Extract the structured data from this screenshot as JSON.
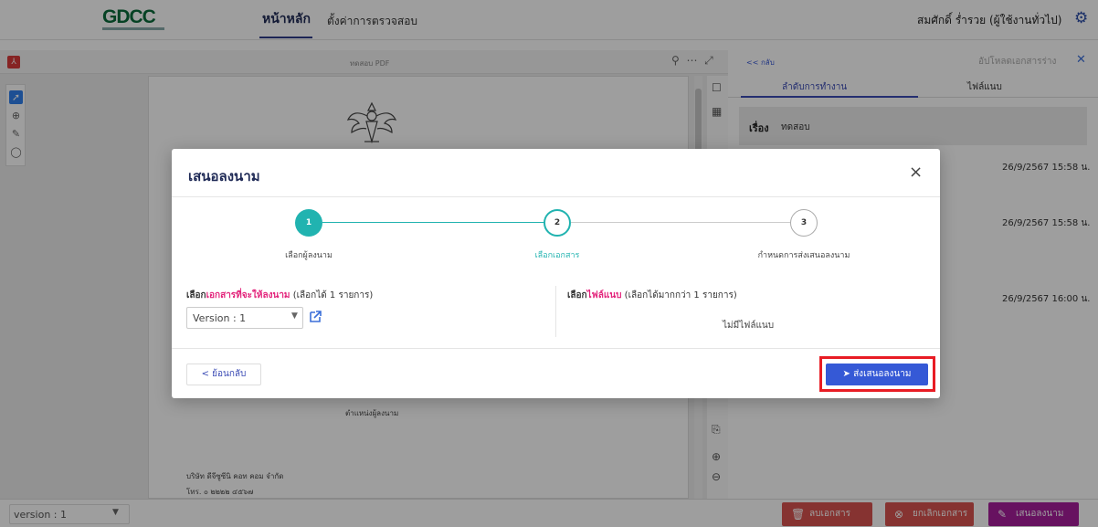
{
  "app": {
    "logo": "GDCC",
    "nav": {
      "home": "หน้าหลัก",
      "settings": "ตั้งค่าการตรวจสอบ"
    },
    "user": "สมศักดิ์ ร่ำรวย (ผู้ใช้งานทั่วไป)"
  },
  "viewer": {
    "pdf_title": "ทดสอบ PDF",
    "page_text": [
      "ตำแหน่งผู้ลงนาม",
      "บริษัท ดีจีซูซีนิ คอท คอม จำกัด",
      "โทร. ๐ ๒๒๒๒ ๔๕๖๗"
    ]
  },
  "right_panel": {
    "back": "<< กลับ",
    "upload_draft": "อัปโหลดเอกสารร่าง",
    "tabs": [
      "ลำดับการทำงาน",
      "ไฟล์แนบ"
    ],
    "subject_label": "เรื่อง",
    "subject_value": "ทดสอบ",
    "dates": [
      "26/9/2567 15:58 น.",
      "26/9/2567 15:58 น.",
      "26/9/2567 16:00 น."
    ]
  },
  "bottom_bar": {
    "version": "version : 1",
    "delete": "ลบเอกสาร",
    "cancel": "ยกเลิกเอกสาร",
    "propose": "เสนอลงนาม"
  },
  "modal": {
    "title": "เสนอลงนาม",
    "steps": [
      {
        "num": "1",
        "label": "เลือกผู้ลงนาม",
        "state": "done"
      },
      {
        "num": "2",
        "label": "เลือกเอกสาร",
        "state": "active"
      },
      {
        "num": "3",
        "label": "กำหนดการส่งเสนอลงนาม",
        "state": "pending"
      }
    ],
    "left_section": {
      "prefix": "เลือก",
      "highlight": "เอกสารที่จะให้ลงนาม",
      "suffix": " (เลือกได้ 1 รายการ)"
    },
    "right_section": {
      "prefix": "เลือก",
      "highlight": "ไฟล์แนบ",
      "suffix": " (เลือกได้มากกว่า 1 รายการ)"
    },
    "version_select": "Version : 1",
    "no_attachment": "ไม่มีไฟล์แนบ",
    "back_button": "< ย้อนกลับ",
    "submit_button": "ส่งเสนอลงนาม"
  },
  "colors": {
    "primary": "#3559d6",
    "step_active": "#21b3b0",
    "highlight": "#e3247b",
    "danger": "#d9534f",
    "purple": "#a61d9c"
  }
}
